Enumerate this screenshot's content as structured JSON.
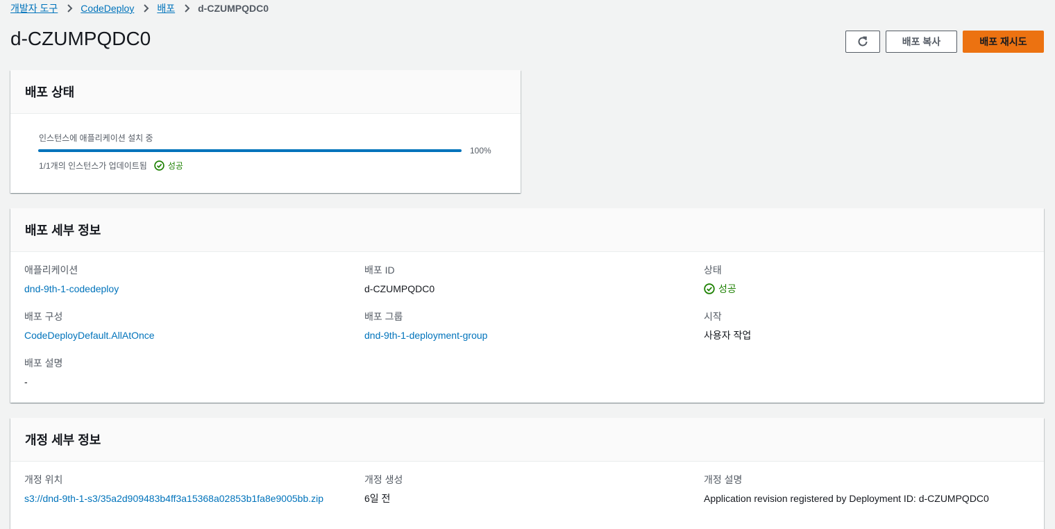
{
  "breadcrumb": {
    "items": [
      "개발자 도구",
      "CodeDeploy",
      "배포"
    ],
    "current": "d-CZUMPQDC0"
  },
  "page": {
    "title": "d-CZUMPQDC0",
    "actions": {
      "refresh_icon": "refresh-icon",
      "copy_label": "배포 복사",
      "retry_label": "배포 재시도"
    }
  },
  "colors": {
    "accent": "#ec7211",
    "link": "#0073bb",
    "success": "#1d8102",
    "progress": "#0073bb"
  },
  "status_panel": {
    "title": "배포 상태",
    "progress_label": "인스턴스에 애플리케이션 설치 중",
    "progress_value": 100,
    "progress_text": "100%",
    "instances_text": "1/1개의 인스턴스가 업데이트됨",
    "result_label": "성공"
  },
  "details_panel": {
    "title": "배포 세부 정보",
    "fields": {
      "application": {
        "label": "애플리케이션",
        "value": "dnd-9th-1-codedeploy"
      },
      "deployment_id": {
        "label": "배포 ID",
        "value": "d-CZUMPQDC0"
      },
      "status": {
        "label": "상태",
        "value": "성공"
      },
      "config": {
        "label": "배포 구성",
        "value": "CodeDeployDefault.AllAtOnce"
      },
      "group": {
        "label": "배포 그룹",
        "value": "dnd-9th-1-deployment-group"
      },
      "initiated": {
        "label": "시작",
        "value": "사용자 작업"
      },
      "description": {
        "label": "배포 설명",
        "value": "-"
      }
    }
  },
  "revision_panel": {
    "title": "개정 세부 정보",
    "fields": {
      "location": {
        "label": "개정 위치",
        "value": "s3://dnd-9th-1-s3/35a2d909483b4ff3a15368a02853b1fa8e9005bb.zip"
      },
      "created": {
        "label": "개정 생성",
        "value": "6일 전"
      },
      "description": {
        "label": "개정 설명",
        "value": "Application revision registered by Deployment ID: d-CZUMPQDC0"
      }
    }
  }
}
